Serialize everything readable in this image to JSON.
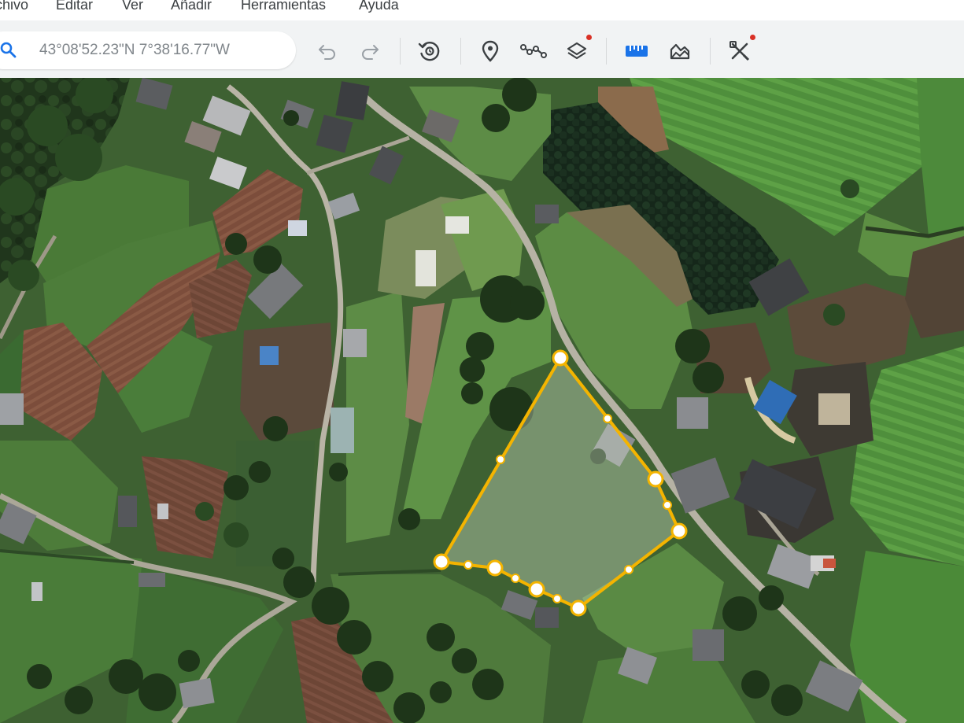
{
  "menubar": {
    "items": [
      {
        "label": "chivo"
      },
      {
        "label": "Editar"
      },
      {
        "label": "Ver"
      },
      {
        "label": "Añadir"
      },
      {
        "label": "Herramientas"
      },
      {
        "label": "Ayuda"
      }
    ]
  },
  "toolbar": {
    "search": {
      "placeholder": "43°08'52.23\"N 7°38'16.77\"W"
    },
    "icons": [
      "undo-icon",
      "redo-icon",
      "historical-imagery-icon",
      "placemark-icon",
      "path-icon",
      "layers-icon",
      "ruler-icon",
      "elevation-profile-icon",
      "tools-icon"
    ],
    "notification_color": "#d93025",
    "accent_color": "#1a73e8"
  },
  "map": {
    "polygon_color": "#f4b400",
    "vertex_fill": "#ffffff"
  }
}
